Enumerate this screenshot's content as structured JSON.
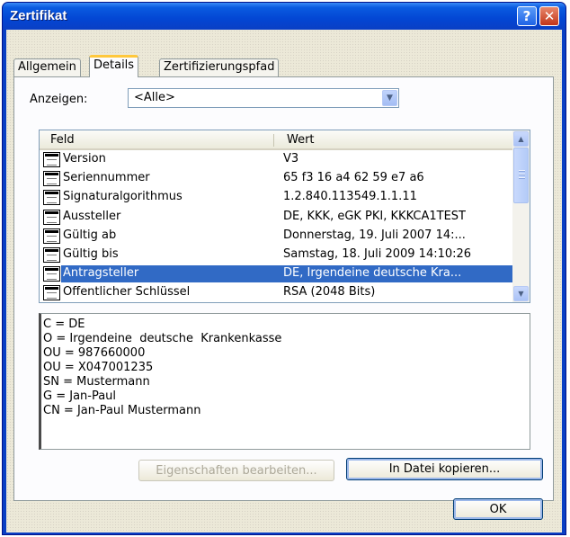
{
  "window": {
    "title": "Zertifikat",
    "help_label": "?",
    "close_label": "✕"
  },
  "tabs": [
    {
      "label": "Allgemein"
    },
    {
      "label": "Details"
    },
    {
      "label": "Zertifizierungspfad"
    }
  ],
  "show": {
    "label": "Anzeigen:",
    "value": "<Alle>",
    "arrow_icon": "chevron-down-icon"
  },
  "list": {
    "columns": [
      "Feld",
      "Wert"
    ],
    "rows": [
      {
        "field": "Version",
        "value": "V3"
      },
      {
        "field": "Seriennummer",
        "value": "65 f3 16 a4 62 59 e7 a6"
      },
      {
        "field": "Signaturalgorithmus",
        "value": "1.2.840.113549.1.1.11"
      },
      {
        "field": "Aussteller",
        "value": "DE, KKK, eGK PKI, KKKCA1TEST"
      },
      {
        "field": "Gültig ab",
        "value": "Donnerstag, 19. Juli 2007 14:..."
      },
      {
        "field": "Gültig bis",
        "value": "Samstag, 18. Juli 2009 14:10:26"
      },
      {
        "field": "Antragsteller",
        "value": "DE, Irgendeine deutsche Kra..."
      },
      {
        "field": "Öffentlicher Schlüssel",
        "value": "RSA (2048 Bits)"
      }
    ],
    "selected_index": 6,
    "selected_color": "#316ac5"
  },
  "detail_lines": [
    "C = DE",
    "O = Irgendeine  deutsche  Krankenkasse",
    "OU = 987660000",
    "OU = X047001235",
    "SN = Mustermann",
    "G = Jan-Paul",
    "CN = Jan-Paul Mustermann"
  ],
  "buttons": {
    "edit_properties": "Eigenschaften bearbeiten...",
    "copy_to_file": "In Datei kopieren...",
    "ok": "OK"
  },
  "colors": {
    "titlebar": "#0a5be0",
    "dialog_bg": "#ece9d8"
  }
}
